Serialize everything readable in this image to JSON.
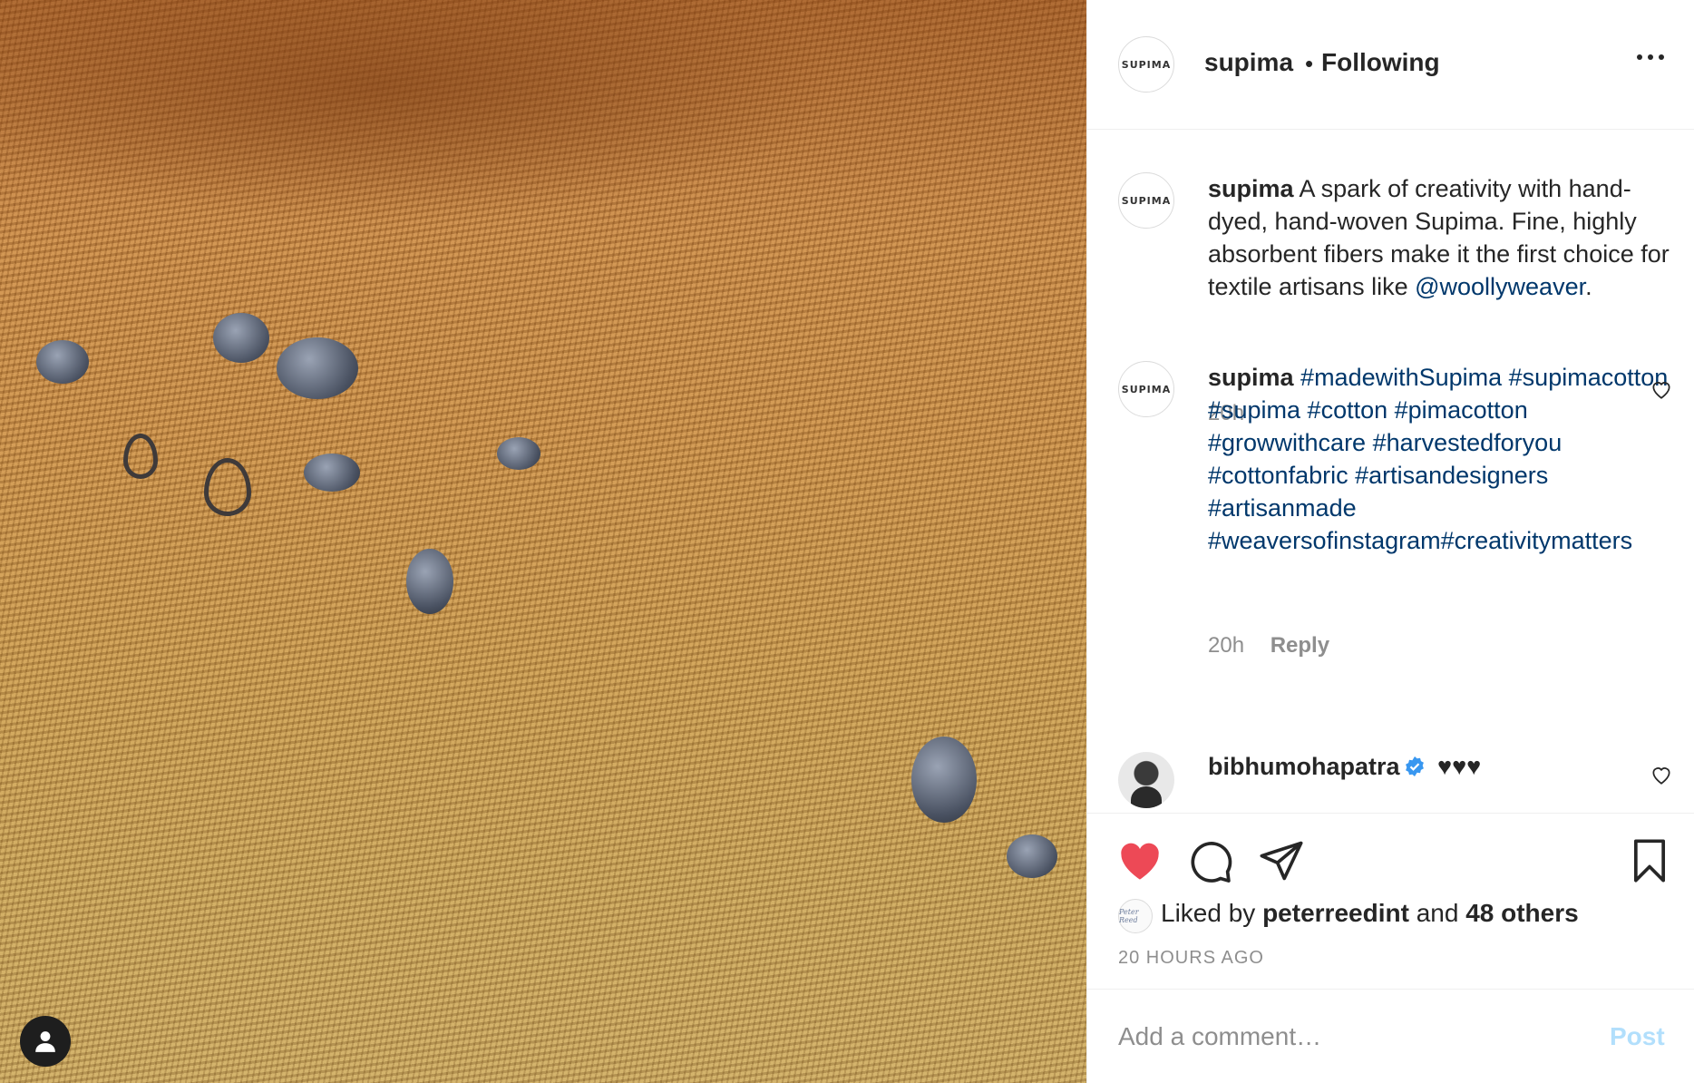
{
  "post": {
    "image_alt": "",
    "account": {
      "username": "supima",
      "logo_text": "SUPIMA",
      "follow_status": "Following",
      "separator": "•"
    }
  },
  "comments": [
    {
      "username": "supima",
      "text": "A spark of creativity with hand-dyed, hand-woven Supima. Fine, highly absorbent fibers make it the first choice for textile artisans like",
      "mention": "@woollyweaver",
      "suffix": ".",
      "time": "20h"
    },
    {
      "username": "supima",
      "hashtags": "#madewithSupima #supimacotton #supima #cotton #pimacotton #growwithcare #harvestedforyou #cottonfabric #artisandesigners #artisanmade #weaversofinstagram#creativitymatters",
      "time": "20h",
      "reply_label": "Reply"
    },
    {
      "username": "bibhumohapatra",
      "text": "♥♥♥"
    }
  ],
  "likes": {
    "prefix": "Liked by",
    "user": "peterreedint",
    "connector": "and",
    "others": "48 others",
    "avatar_text": "Peter Reed"
  },
  "timestamp": "20 HOURS AGO",
  "comment_box": {
    "placeholder": "Add a comment…",
    "post_label": "Post"
  },
  "colors": {
    "like_red": "#ed4956",
    "link_blue": "#00376b",
    "verified_blue": "#3897f0",
    "post_disabled": "#b2dffc"
  }
}
